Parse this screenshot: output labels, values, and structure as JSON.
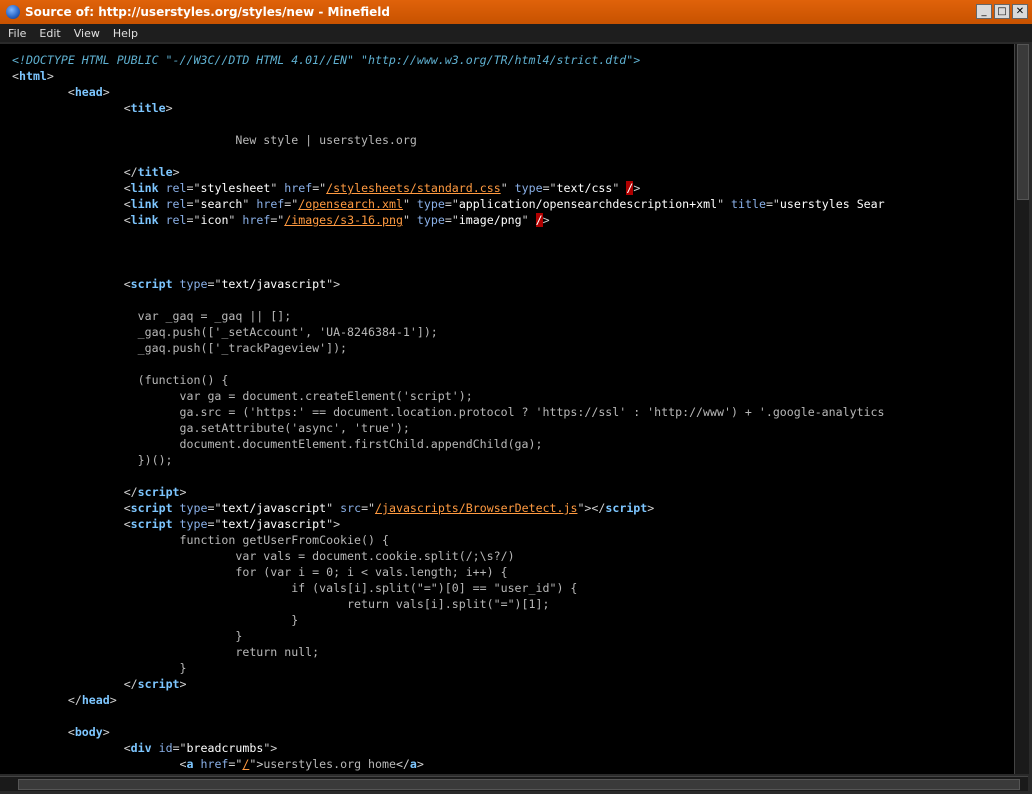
{
  "window": {
    "title": "Source of: http://userstyles.org/styles/new - Minefield",
    "controls": [
      "_",
      "□",
      "✕"
    ]
  },
  "menu": [
    "File",
    "Edit",
    "View",
    "Help"
  ],
  "source_lines": [
    [
      [
        "doctype",
        "<!DOCTYPE HTML PUBLIC \"-//W3C//DTD HTML 4.01//EN\" \"http://www.w3.org/TR/html4/strict.dtd\">"
      ]
    ],
    [
      [
        "brk",
        "<"
      ],
      [
        "tag",
        "html"
      ],
      [
        "brk",
        ">"
      ]
    ],
    [
      [
        "txt",
        "        "
      ],
      [
        "brk",
        "<"
      ],
      [
        "tag",
        "head"
      ],
      [
        "brk",
        ">"
      ]
    ],
    [
      [
        "txt",
        "                "
      ],
      [
        "brk",
        "<"
      ],
      [
        "tag",
        "title"
      ],
      [
        "brk",
        ">"
      ]
    ],
    [
      [
        "txt",
        ""
      ]
    ],
    [
      [
        "txt",
        "                                New style | userstyles.org"
      ]
    ],
    [
      [
        "txt",
        ""
      ]
    ],
    [
      [
        "txt",
        "                "
      ],
      [
        "brk",
        "</"
      ],
      [
        "tag",
        "title"
      ],
      [
        "brk",
        ">"
      ]
    ],
    [
      [
        "txt",
        "                "
      ],
      [
        "brk",
        "<"
      ],
      [
        "tag",
        "link"
      ],
      [
        "txt",
        " "
      ],
      [
        "attr",
        "rel"
      ],
      [
        "brk",
        "=\""
      ],
      [
        "val",
        "stylesheet"
      ],
      [
        "brk",
        "\" "
      ],
      [
        "attr",
        "href"
      ],
      [
        "brk",
        "=\""
      ],
      [
        "link",
        "/stylesheets/standard.css"
      ],
      [
        "brk",
        "\" "
      ],
      [
        "attr",
        "type"
      ],
      [
        "brk",
        "=\""
      ],
      [
        "val",
        "text/css"
      ],
      [
        "brk",
        "\" "
      ],
      [
        "slash-err",
        "/"
      ],
      [
        "brk",
        ">"
      ]
    ],
    [
      [
        "txt",
        "                "
      ],
      [
        "brk",
        "<"
      ],
      [
        "tag",
        "link"
      ],
      [
        "txt",
        " "
      ],
      [
        "attr",
        "rel"
      ],
      [
        "brk",
        "=\""
      ],
      [
        "val",
        "search"
      ],
      [
        "brk",
        "\" "
      ],
      [
        "attr",
        "href"
      ],
      [
        "brk",
        "=\""
      ],
      [
        "link",
        "/opensearch.xml"
      ],
      [
        "brk",
        "\" "
      ],
      [
        "attr",
        "type"
      ],
      [
        "brk",
        "=\""
      ],
      [
        "val",
        "application/opensearchdescription+xml"
      ],
      [
        "brk",
        "\" "
      ],
      [
        "attr",
        "title"
      ],
      [
        "brk",
        "=\""
      ],
      [
        "val",
        "userstyles Sear"
      ]
    ],
    [
      [
        "txt",
        "                "
      ],
      [
        "brk",
        "<"
      ],
      [
        "tag",
        "link"
      ],
      [
        "txt",
        " "
      ],
      [
        "attr",
        "rel"
      ],
      [
        "brk",
        "=\""
      ],
      [
        "val",
        "icon"
      ],
      [
        "brk",
        "\" "
      ],
      [
        "attr",
        "href"
      ],
      [
        "brk",
        "=\""
      ],
      [
        "link",
        "/images/s3-16.png"
      ],
      [
        "brk",
        "\" "
      ],
      [
        "attr",
        "type"
      ],
      [
        "brk",
        "=\""
      ],
      [
        "val",
        "image/png"
      ],
      [
        "brk",
        "\" "
      ],
      [
        "slash-err",
        "/"
      ],
      [
        "brk",
        ">"
      ]
    ],
    [
      [
        "txt",
        ""
      ]
    ],
    [
      [
        "txt",
        ""
      ]
    ],
    [
      [
        "txt",
        ""
      ]
    ],
    [
      [
        "txt",
        "                "
      ],
      [
        "brk",
        "<"
      ],
      [
        "tag",
        "script"
      ],
      [
        "txt",
        " "
      ],
      [
        "attr",
        "type"
      ],
      [
        "brk",
        "=\""
      ],
      [
        "val",
        "text/javascript"
      ],
      [
        "brk",
        "\">"
      ]
    ],
    [
      [
        "txt",
        ""
      ]
    ],
    [
      [
        "txt",
        "                  var _gaq = _gaq || [];"
      ]
    ],
    [
      [
        "txt",
        "                  _gaq.push(['_setAccount', 'UA-8246384-1']);"
      ]
    ],
    [
      [
        "txt",
        "                  _gaq.push(['_trackPageview']);"
      ]
    ],
    [
      [
        "txt",
        ""
      ]
    ],
    [
      [
        "txt",
        "                  (function() {"
      ]
    ],
    [
      [
        "txt",
        "                        var ga = document.createElement('script');"
      ]
    ],
    [
      [
        "txt",
        "                        ga.src = ('https:' == document.location.protocol ? 'https://ssl' : 'http://www') + '.google-analytics"
      ]
    ],
    [
      [
        "txt",
        "                        ga.setAttribute('async', 'true');"
      ]
    ],
    [
      [
        "txt",
        "                        document.documentElement.firstChild.appendChild(ga);"
      ]
    ],
    [
      [
        "txt",
        "                  })();"
      ]
    ],
    [
      [
        "txt",
        ""
      ]
    ],
    [
      [
        "txt",
        "                "
      ],
      [
        "brk",
        "</"
      ],
      [
        "tag",
        "script"
      ],
      [
        "brk",
        ">"
      ]
    ],
    [
      [
        "txt",
        "                "
      ],
      [
        "brk",
        "<"
      ],
      [
        "tag",
        "script"
      ],
      [
        "txt",
        " "
      ],
      [
        "attr",
        "type"
      ],
      [
        "brk",
        "=\""
      ],
      [
        "val",
        "text/javascript"
      ],
      [
        "brk",
        "\" "
      ],
      [
        "attr",
        "src"
      ],
      [
        "brk",
        "=\""
      ],
      [
        "link",
        "/javascripts/BrowserDetect.js"
      ],
      [
        "brk",
        "\"></"
      ],
      [
        "tag",
        "script"
      ],
      [
        "brk",
        ">"
      ]
    ],
    [
      [
        "txt",
        "                "
      ],
      [
        "brk",
        "<"
      ],
      [
        "tag",
        "script"
      ],
      [
        "txt",
        " "
      ],
      [
        "attr",
        "type"
      ],
      [
        "brk",
        "=\""
      ],
      [
        "val",
        "text/javascript"
      ],
      [
        "brk",
        "\">"
      ]
    ],
    [
      [
        "txt",
        "                        function getUserFromCookie() {"
      ]
    ],
    [
      [
        "txt",
        "                                var vals = document.cookie.split(/;\\s?/)"
      ]
    ],
    [
      [
        "txt",
        "                                for (var i = 0; i < vals.length; i++) {"
      ]
    ],
    [
      [
        "txt",
        "                                        if (vals[i].split(\"=\")[0] == \"user_id\") {"
      ]
    ],
    [
      [
        "txt",
        "                                                return vals[i].split(\"=\")[1];"
      ]
    ],
    [
      [
        "txt",
        "                                        }"
      ]
    ],
    [
      [
        "txt",
        "                                }"
      ]
    ],
    [
      [
        "txt",
        "                                return null;"
      ]
    ],
    [
      [
        "txt",
        "                        }"
      ]
    ],
    [
      [
        "txt",
        "                "
      ],
      [
        "brk",
        "</"
      ],
      [
        "tag",
        "script"
      ],
      [
        "brk",
        ">"
      ]
    ],
    [
      [
        "txt",
        "        "
      ],
      [
        "brk",
        "</"
      ],
      [
        "tag",
        "head"
      ],
      [
        "brk",
        ">"
      ]
    ],
    [
      [
        "txt",
        ""
      ]
    ],
    [
      [
        "txt",
        "        "
      ],
      [
        "brk",
        "<"
      ],
      [
        "tag",
        "body"
      ],
      [
        "brk",
        ">"
      ]
    ],
    [
      [
        "txt",
        "                "
      ],
      [
        "brk",
        "<"
      ],
      [
        "tag",
        "div"
      ],
      [
        "txt",
        " "
      ],
      [
        "attr",
        "id"
      ],
      [
        "brk",
        "=\""
      ],
      [
        "val",
        "breadcrumbs"
      ],
      [
        "brk",
        "\">"
      ]
    ],
    [
      [
        "txt",
        "                        "
      ],
      [
        "brk",
        "<"
      ],
      [
        "tag",
        "a"
      ],
      [
        "txt",
        " "
      ],
      [
        "attr",
        "href"
      ],
      [
        "brk",
        "=\""
      ],
      [
        "link",
        "/"
      ],
      [
        "brk",
        "\">"
      ],
      [
        "txt",
        "userstyles.org home"
      ],
      [
        "brk",
        "</"
      ],
      [
        "tag",
        "a"
      ],
      [
        "brk",
        ">"
      ]
    ]
  ]
}
